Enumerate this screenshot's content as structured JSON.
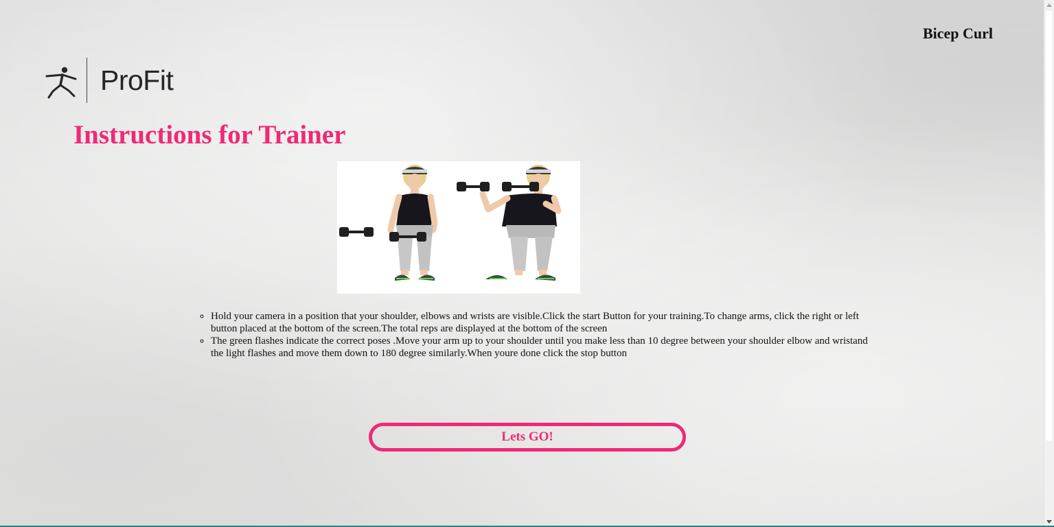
{
  "header": {
    "exercise_name": "Bicep Curl"
  },
  "logo": {
    "text": "ProFit",
    "icon": "yoga-figure-icon"
  },
  "main": {
    "heading": "Instructions for Trainer",
    "image_alt": "bicep curl demonstration",
    "instructions": [
      "Hold your camera in a position that your shoulder, elbows and wrists are visible.Click the start Button for your training.To change arms, click the right or left button placed at the bottom of the screen.The total reps are displayed at the bottom of the screen",
      "The green flashes indicate the correct poses .Move your arm up to your shoulder until you make less than 10 degree between your shoulder elbow and wristand the light flashes and move them down to 180 degree similarly.When youre done click the stop button"
    ],
    "start_button_label": "Lets GO!"
  },
  "colors": {
    "accent": "#ee2a76",
    "text": "#111111"
  }
}
